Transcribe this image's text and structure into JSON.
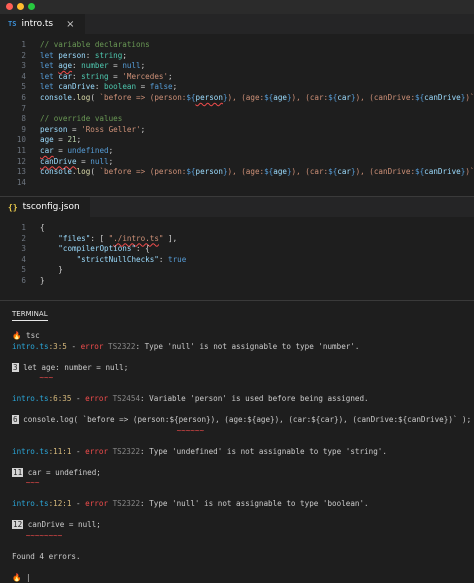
{
  "window": {
    "colors": {
      "close": "#ff5f56",
      "minimize": "#ffbd2e",
      "maximize": "#27c93f"
    }
  },
  "tabs": {
    "editor1": {
      "icon": "TS",
      "label": "intro.ts",
      "close": "×"
    },
    "editor2": {
      "icon": "{}",
      "label": "tsconfig.json"
    }
  },
  "editor1": {
    "lines": [
      {
        "n": "1"
      },
      {
        "n": "2"
      },
      {
        "n": "3"
      },
      {
        "n": "4"
      },
      {
        "n": "5"
      },
      {
        "n": "6"
      },
      {
        "n": "7"
      },
      {
        "n": "8"
      },
      {
        "n": "9"
      },
      {
        "n": "10"
      },
      {
        "n": "11"
      },
      {
        "n": "12"
      },
      {
        "n": "13"
      },
      {
        "n": "14"
      }
    ]
  },
  "editor2": {
    "lines": [
      {
        "n": "1"
      },
      {
        "n": "2"
      },
      {
        "n": "3"
      },
      {
        "n": "4"
      },
      {
        "n": "5"
      },
      {
        "n": "6"
      }
    ]
  },
  "terminal": {
    "tab_label": "TERMINAL",
    "lines": [
      "🔥 tsc",
      "intro.ts:3:5 - error TS2322: Type 'null' is not assignable to type 'number'.",
      "",
      "3 let age: number = null;",
      "      ~~~",
      "",
      "intro.ts:6:35 - error TS2454: Variable 'person' is used before being assigned.",
      "",
      "6 console.log( `before => (person:${person}), (age:${age}), (car:${car}), (canDrive:${canDrive})` );",
      "                                    ~~~~~~",
      "",
      "intro.ts:11:1 - error TS2322: Type 'undefined' is not assignable to type 'string'.",
      "",
      "11 car = undefined;",
      "   ~~~",
      "",
      "intro.ts:12:1 - error TS2322: Type 'null' is not assignable to type 'boolean'.",
      "",
      "12 canDrive = null;",
      "   ~~~~~~~~",
      "",
      "Found 4 errors.",
      "",
      "🔥 |"
    ]
  }
}
